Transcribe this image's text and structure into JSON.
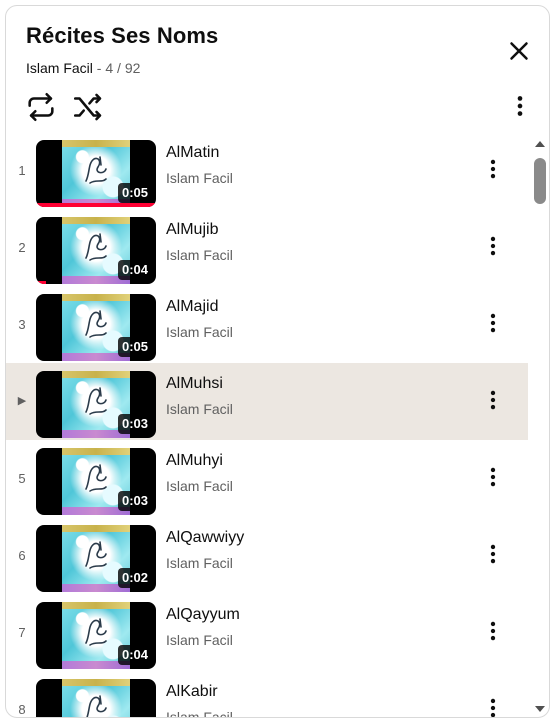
{
  "header": {
    "title": "Récites Ses Noms",
    "channel": "Islam Facil",
    "separator": "-",
    "position": "4 / 92"
  },
  "icons": {
    "close": "close-icon",
    "loop": "loop-icon",
    "shuffle": "shuffle-icon",
    "more": "more-vert-icon",
    "now_playing": "play-indicator-icon"
  },
  "colors": {
    "accent_red": "#ff0033",
    "active_row": "#ece7e1",
    "secondary_text": "#606060"
  },
  "playlist": [
    {
      "index": "1",
      "title": "AlMatin",
      "channel": "Islam Facil",
      "duration": "0:05",
      "watched_progress": 1.0,
      "playing": false
    },
    {
      "index": "2",
      "title": "AlMujib",
      "channel": "Islam Facil",
      "duration": "0:04",
      "watched_progress": 0.0,
      "playing": false
    },
    {
      "index": "3",
      "title": "AlMajid",
      "channel": "Islam Facil",
      "duration": "0:05",
      "watched_progress": 0.0,
      "playing": false
    },
    {
      "index": "▶",
      "title": "AlMuhsi",
      "channel": "Islam Facil",
      "duration": "0:03",
      "watched_progress": 0.0,
      "playing": true
    },
    {
      "index": "5",
      "title": "AlMuhyi",
      "channel": "Islam Facil",
      "duration": "0:03",
      "watched_progress": 0.0,
      "playing": false
    },
    {
      "index": "6",
      "title": "AlQawwiyy",
      "channel": "Islam Facil",
      "duration": "0:02",
      "watched_progress": 0.0,
      "playing": false
    },
    {
      "index": "7",
      "title": "AlQayyum",
      "channel": "Islam Facil",
      "duration": "0:04",
      "watched_progress": 0.0,
      "playing": false
    },
    {
      "index": "8",
      "title": "AlKabir",
      "channel": "Islam Facil",
      "duration": "",
      "watched_progress": 0.0,
      "playing": false
    }
  ]
}
